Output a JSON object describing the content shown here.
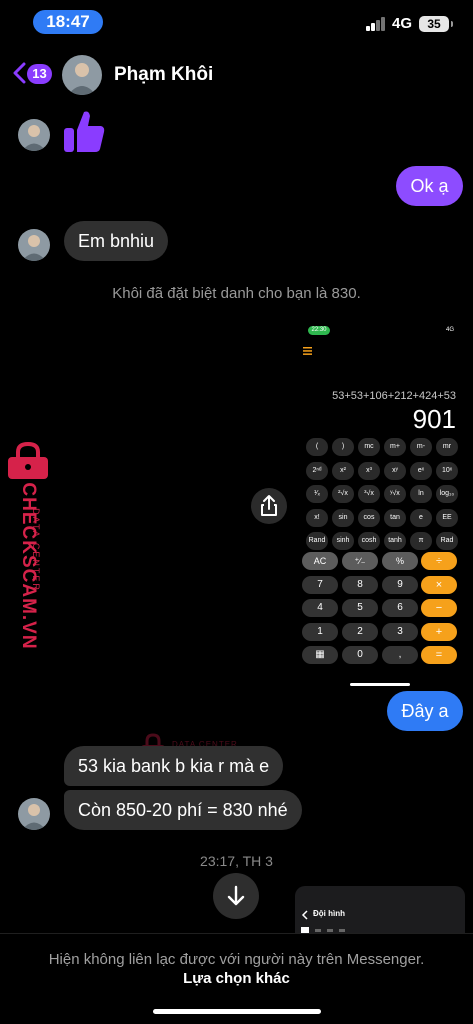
{
  "status_bar": {
    "time": "18:47",
    "network": "4G",
    "battery": "35"
  },
  "header": {
    "unread_count": "13",
    "contact_name": "Phạm Khôi"
  },
  "messages": {
    "outgoing_1": "Ok ạ",
    "incoming_1": "Em bnhiu",
    "system_note": "Khôi đã đặt biệt danh cho bạn là 830.",
    "outgoing_2": "Đây a",
    "incoming_2": "53 kia bank b kia r mà e",
    "incoming_3": "Còn 850-20 phí = 830 nhé",
    "timestamp": "23:17, TH 3"
  },
  "calculator_screenshot": {
    "time": "22:30",
    "status": "4G",
    "expression": "53+53+106+212+424+53",
    "result": "901",
    "sci_rows": [
      [
        "(",
        ")",
        "mc",
        "m+",
        "m-",
        "mr"
      ],
      [
        "2ⁿᵈ",
        "x²",
        "x³",
        "xʸ",
        "eˣ",
        "10ˣ"
      ],
      [
        "¹⁄ₓ",
        "²√x",
        "³√x",
        "ʸ√x",
        "ln",
        "log₁₀"
      ],
      [
        "x!",
        "sin",
        "cos",
        "tan",
        "e",
        "EE"
      ],
      [
        "Rand",
        "sinh",
        "cosh",
        "tanh",
        "π",
        "Rad"
      ]
    ],
    "main_rows": [
      [
        "AC",
        "⁺∕₋",
        "%",
        "÷"
      ],
      [
        "7",
        "8",
        "9",
        "×"
      ],
      [
        "4",
        "5",
        "6",
        "−"
      ],
      [
        "1",
        "2",
        "3",
        "+"
      ],
      [
        "▦",
        "0",
        ",",
        "="
      ]
    ]
  },
  "preview": {
    "title": "Đội hình"
  },
  "watermark": {
    "main": "CHECKSCAM.VN",
    "sub": "DATA CENTER"
  },
  "footer": {
    "notice": "Hiện không liên lạc được với người này trên Messenger.",
    "link": "Lựa chọn khác"
  },
  "colors": {
    "outgoing": "#8d4cff",
    "outgoing_alt": "#2f7bf5",
    "incoming": "#303030",
    "accent": "#8a3cff",
    "watermark": "#d6224a"
  }
}
